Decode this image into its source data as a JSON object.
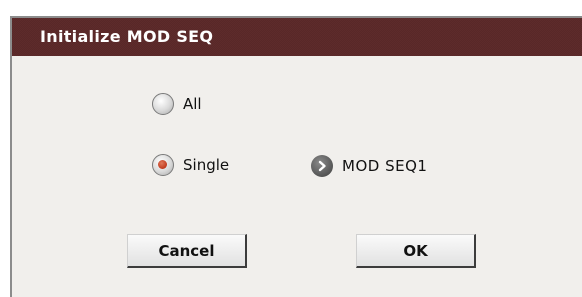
{
  "dialog": {
    "title": "Initialize MOD SEQ"
  },
  "options": {
    "all_label": "All",
    "single_label": "Single",
    "selected": "Single"
  },
  "seq_selector": {
    "label": "MOD SEQ1",
    "icon": "chevron-right-icon"
  },
  "buttons": {
    "cancel_label": "Cancel",
    "ok_label": "OK"
  },
  "colors": {
    "title_bar": "#5e2b2b",
    "dialog_bg": "#f1efec",
    "radio_selected": "#c03a1e"
  }
}
